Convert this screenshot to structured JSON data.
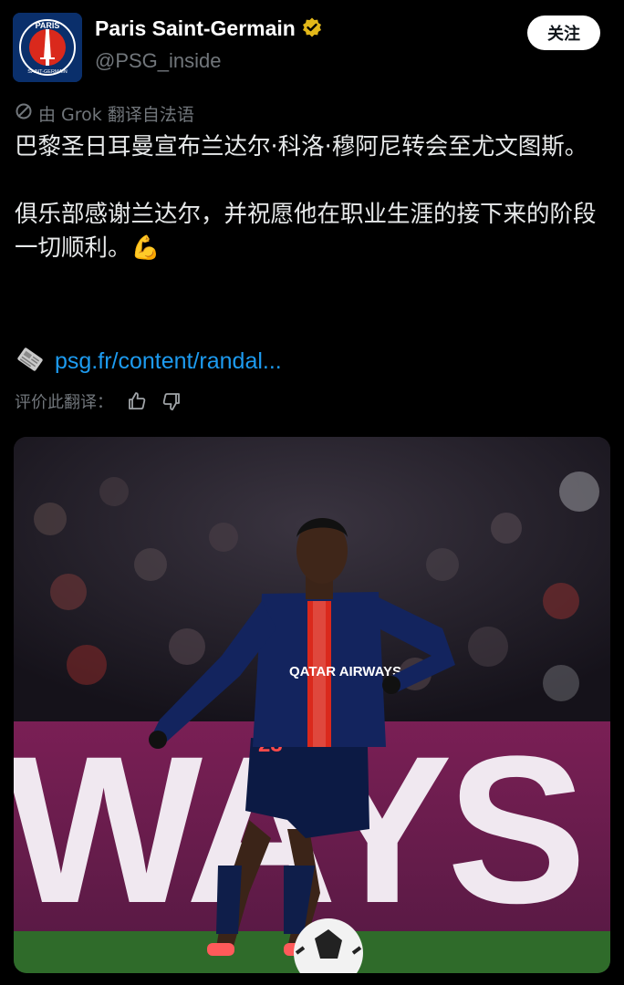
{
  "account": {
    "name": "Paris Saint-Germain",
    "handle": "@PSG_inside",
    "avatar_text": "PARIS SAINT-GERMAIN",
    "verified_color": "#e2b719"
  },
  "follow_label": "关注",
  "translation_notice": "由 Grok 翻译自法语",
  "post": {
    "paragraph1": "巴黎圣日耳曼宣布兰达尔·科洛·穆阿尼转会至尤文图斯。",
    "paragraph2": "俱乐部感谢兰达尔，并祝愿他在职业生涯的接下来的阶段一切顺利。💪"
  },
  "link": {
    "icon": "newspaper-icon",
    "text": "psg.fr/content/randal..."
  },
  "rate_translation": {
    "label": "评价此翻译：",
    "up_icon": "thumbs-up-icon",
    "down_icon": "thumbs-down-icon"
  },
  "media": {
    "description_icon": "photo",
    "sponsor_text": "QATAR AIRWAYS",
    "shirt_number": "23",
    "board_text": "WAYS"
  },
  "colors": {
    "background": "#000000",
    "text": "#e7e9ea",
    "muted": "#71767b",
    "link": "#1d9bf0",
    "psg_navy": "#0a2f6b",
    "psg_red": "#da291c"
  }
}
